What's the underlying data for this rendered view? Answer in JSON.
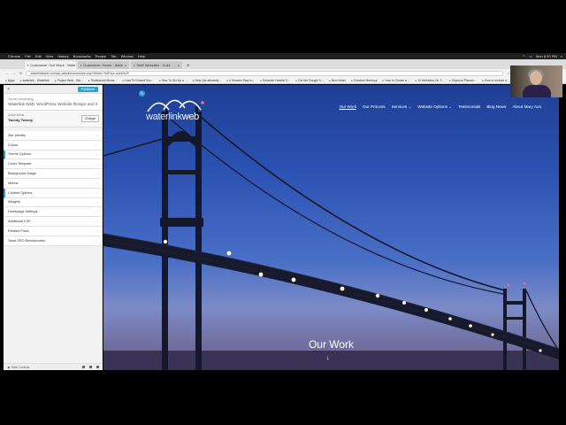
{
  "menubar": {
    "items": [
      "Chrome",
      "File",
      "Edit",
      "View",
      "History",
      "Bookmarks",
      "People",
      "Tab",
      "Window",
      "Help"
    ],
    "clock": "Mon 6:20 PM"
  },
  "tabs": [
    {
      "label": "Customize: Our Work · Wate",
      "active": true
    },
    {
      "label": "Customize: Home · Wate",
      "active": false
    },
    {
      "label": "Staff Websites · Cust",
      "active": false
    }
  ],
  "address": {
    "url": "waterlinkweb.com/wp-admin/customize.php?return=%2Four-work%2F"
  },
  "bookmarks": [
    "Apps",
    "waterlink - Waterlink",
    "Project Web - Wa...",
    "Testimonial Movie...",
    "How To Embed Soc...",
    "How To Set Up a ...",
    "Help (wk allowed)...",
    "A Smarter Way to...",
    "Smashin Hobble D...",
    "Get the Google S...",
    "New folder",
    "Creative Meetups",
    "How to Create a ...",
    "10 Websites On T...",
    "Keyword Planner...",
    "How to include a ..."
  ],
  "customizer": {
    "publish_label": "Published",
    "customizing_label": "You are customizing",
    "site_name": "Waterlink Web: WordPress Website Design and S...",
    "active_theme_label": "Active theme",
    "theme_name": "Twenty Twenty",
    "change_label": "Change",
    "items": [
      {
        "label": "Site Identity"
      },
      {
        "label": "Colors"
      },
      {
        "label": "Theme Options"
      },
      {
        "label": "Cover Template"
      },
      {
        "label": "Background Image"
      },
      {
        "label": "Menus"
      },
      {
        "label": "Content Options"
      },
      {
        "label": "Widgets"
      },
      {
        "label": "Homepage Settings"
      },
      {
        "label": "Additional CSS"
      },
      {
        "label": "Related Posts"
      },
      {
        "label": "Yoast SEO Breadcrumbs"
      }
    ],
    "hide_controls_label": "Hide Controls"
  },
  "preview": {
    "logo_part1": "waterlink",
    "logo_part2": "web",
    "nav": [
      "Our Work",
      "Our Process",
      "Services ⌄",
      "Website Options ⌄",
      "Testimonials",
      "Blog News",
      "About Mary Ann"
    ],
    "hero_title": "Our Work",
    "hero_arrow": "↓"
  },
  "colors": {
    "accent": "#2ea2cc"
  }
}
